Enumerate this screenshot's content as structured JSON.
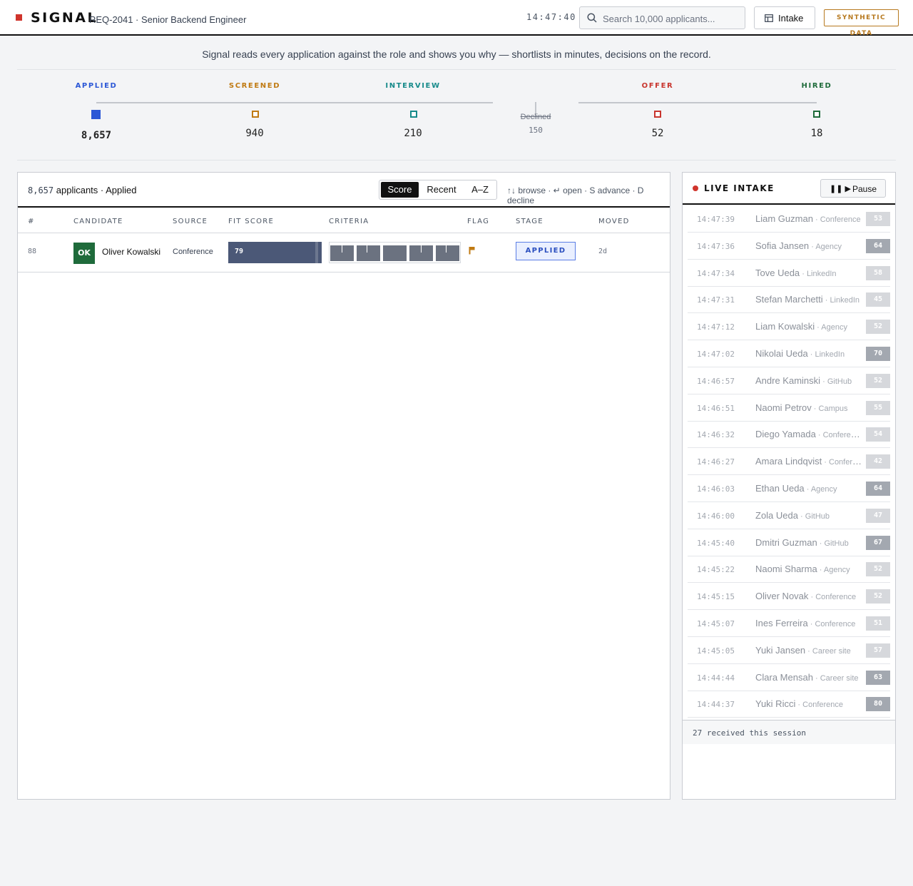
{
  "header": {
    "logo": "SIGNAL",
    "requisition": "REQ-2041 · Senior Backend Engineer",
    "clock": "14:47:40",
    "search_placeholder": "Search 10,000 applicants...",
    "intake_label": "Intake",
    "synthetic_badge": "SYNTHETIC DATA"
  },
  "tagline": "Signal reads every application against the role and shows you why — shortlists in minutes, decisions on the record.",
  "funnel": {
    "stages": [
      {
        "label": "APPLIED",
        "count": "8,657",
        "color": "#2b57d6"
      },
      {
        "label": "SCREENED",
        "count": "940",
        "color": "#c07a12"
      },
      {
        "label": "INTERVIEW",
        "count": "210",
        "color": "#168a8a"
      },
      {
        "label": "OFFER",
        "count": "52",
        "color": "#c8352e"
      },
      {
        "label": "HIRED",
        "count": "18",
        "color": "#1f6b3b"
      }
    ],
    "declined": {
      "label": "Declined",
      "count": "150"
    }
  },
  "applicants": {
    "count": "8,657",
    "count_suffix": "applicants · Applied",
    "sort_options": [
      "Score",
      "Recent",
      "A–Z"
    ],
    "sort_selected": "Score",
    "shortcuts": "↑↓ browse · ↵ open · S advance · D decline",
    "columns": [
      "#",
      "CANDIDATE",
      "SOURCE",
      "FIT SCORE",
      "CRITERIA",
      "FLAG",
      "STAGE",
      "MOVED"
    ],
    "rows": [
      {
        "index": "88",
        "initials": "OK",
        "name": "Oliver Kowalski",
        "source": "Conference",
        "fit": "79",
        "fit_fraction": 0.96,
        "stage": "APPLIED",
        "moved": "2d"
      }
    ]
  },
  "live_intake": {
    "title": "LIVE INTAKE",
    "pause_icon": "❚❚ ▶",
    "pause_label": "Pause",
    "items": [
      {
        "time": "14:47:39",
        "name": "Liam Guzman",
        "source": "Conference",
        "score": "53"
      },
      {
        "time": "14:47:36",
        "name": "Sofia Jansen",
        "source": "Agency",
        "score": "64"
      },
      {
        "time": "14:47:34",
        "name": "Tove Ueda",
        "source": "LinkedIn",
        "score": "58"
      },
      {
        "time": "14:47:31",
        "name": "Stefan Marchetti",
        "source": "LinkedIn",
        "score": "45"
      },
      {
        "time": "14:47:12",
        "name": "Liam Kowalski",
        "source": "Agency",
        "score": "52"
      },
      {
        "time": "14:47:02",
        "name": "Nikolai Ueda",
        "source": "LinkedIn",
        "score": "70"
      },
      {
        "time": "14:46:57",
        "name": "Andre Kaminski",
        "source": "GitHub",
        "score": "52"
      },
      {
        "time": "14:46:51",
        "name": "Naomi Petrov",
        "source": "Campus",
        "score": "55"
      },
      {
        "time": "14:46:32",
        "name": "Diego Yamada",
        "source": "Conference",
        "score": "54"
      },
      {
        "time": "14:46:27",
        "name": "Amara Lindqvist",
        "source": "Conference",
        "score": "42"
      },
      {
        "time": "14:46:03",
        "name": "Ethan Ueda",
        "source": "Agency",
        "score": "64"
      },
      {
        "time": "14:46:00",
        "name": "Zola Ueda",
        "source": "GitHub",
        "score": "47"
      },
      {
        "time": "14:45:40",
        "name": "Dmitri Guzman",
        "source": "GitHub",
        "score": "67"
      },
      {
        "time": "14:45:22",
        "name": "Naomi Sharma",
        "source": "Agency",
        "score": "52"
      },
      {
        "time": "14:45:15",
        "name": "Oliver Novak",
        "source": "Conference",
        "score": "52"
      },
      {
        "time": "14:45:07",
        "name": "Ines Ferreira",
        "source": "Conference",
        "score": "51"
      },
      {
        "time": "14:45:05",
        "name": "Yuki Jansen",
        "source": "Career site",
        "score": "57"
      },
      {
        "time": "14:44:44",
        "name": "Clara Mensah",
        "source": "Career site",
        "score": "63"
      },
      {
        "time": "14:44:37",
        "name": "Yuki Ricci",
        "source": "Conference",
        "score": "80"
      }
    ],
    "footer": "27 received this session"
  }
}
